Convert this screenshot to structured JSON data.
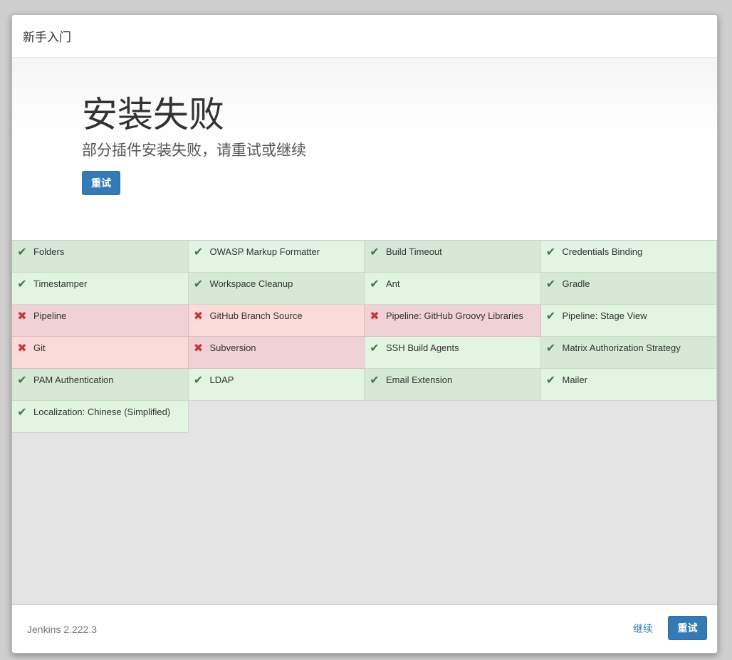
{
  "dialog": {
    "title": "新手入门"
  },
  "hero": {
    "title": "安装失败",
    "subtitle": "部分插件安装失败，请重试或继续",
    "retry_label": "重试"
  },
  "plugins": [
    {
      "name": "Folders",
      "status": "success"
    },
    {
      "name": "OWASP Markup Formatter",
      "status": "success"
    },
    {
      "name": "Build Timeout",
      "status": "success"
    },
    {
      "name": "Credentials Binding",
      "status": "success"
    },
    {
      "name": "Timestamper",
      "status": "success"
    },
    {
      "name": "Workspace Cleanup",
      "status": "success"
    },
    {
      "name": "Ant",
      "status": "success"
    },
    {
      "name": "Gradle",
      "status": "success"
    },
    {
      "name": "Pipeline",
      "status": "fail"
    },
    {
      "name": "GitHub Branch Source",
      "status": "fail"
    },
    {
      "name": "Pipeline: GitHub Groovy Libraries",
      "status": "fail"
    },
    {
      "name": "Pipeline: Stage View",
      "status": "success"
    },
    {
      "name": "Git",
      "status": "fail"
    },
    {
      "name": "Subversion",
      "status": "fail"
    },
    {
      "name": "SSH Build Agents",
      "status": "success"
    },
    {
      "name": "Matrix Authorization Strategy",
      "status": "success"
    },
    {
      "name": "PAM Authentication",
      "status": "success"
    },
    {
      "name": "LDAP",
      "status": "success"
    },
    {
      "name": "Email Extension",
      "status": "success"
    },
    {
      "name": "Mailer",
      "status": "success"
    },
    {
      "name": "Localization: Chinese (Simplified)",
      "status": "success"
    }
  ],
  "icons": {
    "success": "check-icon",
    "fail": "cross-icon"
  },
  "colors": {
    "primary": "#337ab7",
    "success_bg": "#d6e9d6",
    "success_icon": "#3c7d3c",
    "fail_bg": "#f0d2d4",
    "fail_icon": "#c0393b"
  },
  "footer": {
    "version": "Jenkins 2.222.3",
    "continue_label": "继续",
    "retry_label": "重试"
  }
}
